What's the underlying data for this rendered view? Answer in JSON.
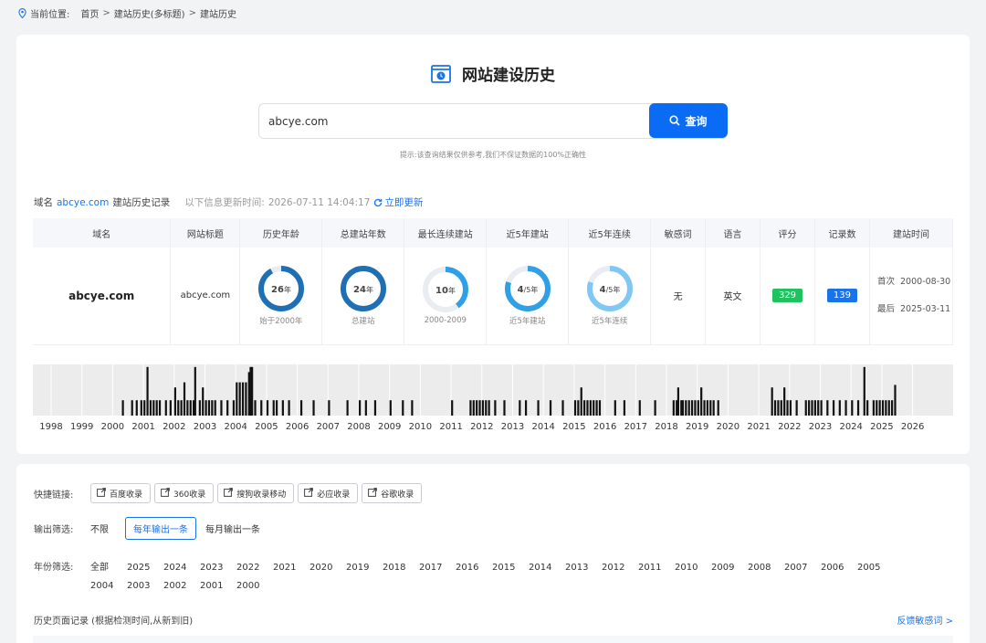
{
  "breadcrumb": {
    "prefix": "当前位置:",
    "items": [
      "首页",
      "建站历史(多标题)",
      "建站历史"
    ],
    "sep": ">"
  },
  "header": {
    "title": "网站建设历史"
  },
  "search": {
    "value": "abcye.com",
    "button_label": "查询"
  },
  "tip": "提示:该查询结果仅供参考,我们不保证数据的100%正确性",
  "info": {
    "prefix": "域名",
    "domain": "abcye.com",
    "suffix": "建站历史记录",
    "updated_label": "以下信息更新时间:",
    "updated_time": "2026-07-11 14:04:17",
    "refresh_label": "立即更新"
  },
  "table": {
    "headers": [
      "域名",
      "网站标题",
      "历史年龄",
      "总建站年数",
      "最长连续建站",
      "近5年建站",
      "近5年连续",
      "敏感词",
      "语言",
      "评分",
      "记录数",
      "建站时间"
    ],
    "domain": "abcye.com",
    "site_title": "abcye.com",
    "rings": [
      {
        "main": "26",
        "unit": "年",
        "sub": "始于2000年",
        "fraction": 0.92,
        "color": "#1f6fb5"
      },
      {
        "main": "24",
        "unit": "年",
        "sub": "总建站",
        "fraction": 1.0,
        "color": "#1f6fb5"
      },
      {
        "main": "10",
        "unit": "年",
        "sub": "2000-2009",
        "fraction": 0.4,
        "color": "#2fa0e6"
      },
      {
        "main": "4",
        "unit": "/5年",
        "sub": "近5年建站",
        "fraction": 0.8,
        "color": "#2fa0e6"
      },
      {
        "main": "4",
        "unit": "/5年",
        "sub": "近5年连续",
        "fraction": 0.8,
        "color": "#7fc8f5"
      }
    ],
    "sensitive": "无",
    "language": "英文",
    "score": "329",
    "score_color": "#1ec25e",
    "records": "139",
    "records_color": "#1a73e8",
    "first_label": "首次",
    "first_date": "2000-08-30",
    "last_label": "最后",
    "last_date": "2025-03-11"
  },
  "timeline": {
    "years": [
      "1998",
      "1999",
      "2000",
      "2001",
      "2002",
      "2003",
      "2004",
      "2005",
      "2006",
      "2007",
      "2008",
      "2009",
      "2010",
      "2011",
      "2012",
      "2013",
      "2014",
      "2015",
      "2016",
      "2017",
      "2018",
      "2019",
      "2020",
      "2021",
      "2022",
      "2023",
      "2024",
      "2025",
      "2026"
    ],
    "bar_color": "#111111",
    "bars": [
      [
        2000.3,
        0.3
      ],
      [
        2000.6,
        0.3
      ],
      [
        2000.75,
        0.3
      ],
      [
        2000.9,
        0.3
      ],
      [
        2001.0,
        0.3
      ],
      [
        2001.1,
        0.95
      ],
      [
        2001.2,
        0.3
      ],
      [
        2001.3,
        0.3
      ],
      [
        2001.4,
        0.3
      ],
      [
        2001.5,
        0.3
      ],
      [
        2001.7,
        0.3
      ],
      [
        2001.85,
        0.3
      ],
      [
        2002.0,
        0.55
      ],
      [
        2002.1,
        0.3
      ],
      [
        2002.2,
        0.3
      ],
      [
        2002.3,
        0.65
      ],
      [
        2002.4,
        0.3
      ],
      [
        2002.5,
        0.3
      ],
      [
        2002.6,
        0.3
      ],
      [
        2002.65,
        0.95
      ],
      [
        2002.8,
        0.3
      ],
      [
        2002.9,
        0.55
      ],
      [
        2003.0,
        0.3
      ],
      [
        2003.1,
        0.3
      ],
      [
        2003.2,
        0.3
      ],
      [
        2003.3,
        0.3
      ],
      [
        2003.5,
        0.3
      ],
      [
        2003.7,
        0.3
      ],
      [
        2003.9,
        0.3
      ],
      [
        2004.0,
        0.65
      ],
      [
        2004.1,
        0.65
      ],
      [
        2004.2,
        0.65
      ],
      [
        2004.3,
        0.65
      ],
      [
        2004.4,
        0.85
      ],
      [
        2004.45,
        0.95
      ],
      [
        2004.5,
        0.95
      ],
      [
        2004.6,
        0.3
      ],
      [
        2004.8,
        0.3
      ],
      [
        2005.0,
        0.3
      ],
      [
        2005.2,
        0.3
      ],
      [
        2005.3,
        0.3
      ],
      [
        2005.5,
        0.3
      ],
      [
        2005.7,
        0.3
      ],
      [
        2006.1,
        0.3
      ],
      [
        2006.5,
        0.3
      ],
      [
        2007.0,
        0.3
      ],
      [
        2007.6,
        0.3
      ],
      [
        2008.0,
        0.3
      ],
      [
        2008.2,
        0.3
      ],
      [
        2008.5,
        0.3
      ],
      [
        2009.0,
        0.3
      ],
      [
        2009.4,
        0.3
      ],
      [
        2009.7,
        0.3
      ],
      [
        2011.0,
        0.3
      ],
      [
        2011.6,
        0.3
      ],
      [
        2011.7,
        0.3
      ],
      [
        2011.8,
        0.3
      ],
      [
        2011.9,
        0.3
      ],
      [
        2012.0,
        0.3
      ],
      [
        2012.1,
        0.3
      ],
      [
        2012.2,
        0.3
      ],
      [
        2012.4,
        0.3
      ],
      [
        2012.7,
        0.3
      ],
      [
        2013.2,
        0.3
      ],
      [
        2013.4,
        0.3
      ],
      [
        2013.8,
        0.3
      ],
      [
        2014.2,
        0.3
      ],
      [
        2014.6,
        0.3
      ],
      [
        2015.0,
        0.3
      ],
      [
        2015.1,
        0.3
      ],
      [
        2015.2,
        0.55
      ],
      [
        2015.3,
        0.3
      ],
      [
        2015.4,
        0.3
      ],
      [
        2015.5,
        0.3
      ],
      [
        2015.6,
        0.3
      ],
      [
        2015.7,
        0.3
      ],
      [
        2015.8,
        0.3
      ],
      [
        2016.3,
        0.3
      ],
      [
        2016.6,
        0.3
      ],
      [
        2017.1,
        0.3
      ],
      [
        2017.6,
        0.3
      ],
      [
        2018.2,
        0.3
      ],
      [
        2018.3,
        0.3
      ],
      [
        2018.35,
        0.55
      ],
      [
        2018.45,
        0.3
      ],
      [
        2018.5,
        0.3
      ],
      [
        2018.6,
        0.3
      ],
      [
        2018.7,
        0.3
      ],
      [
        2018.8,
        0.3
      ],
      [
        2018.9,
        0.3
      ],
      [
        2019.0,
        0.3
      ],
      [
        2019.1,
        0.55
      ],
      [
        2019.2,
        0.3
      ],
      [
        2019.3,
        0.3
      ],
      [
        2019.4,
        0.3
      ],
      [
        2019.5,
        0.3
      ],
      [
        2019.65,
        0.3
      ],
      [
        2021.4,
        0.55
      ],
      [
        2021.5,
        0.3
      ],
      [
        2021.6,
        0.3
      ],
      [
        2021.7,
        0.3
      ],
      [
        2021.8,
        0.55
      ],
      [
        2021.9,
        0.3
      ],
      [
        2022.0,
        0.3
      ],
      [
        2022.2,
        0.3
      ],
      [
        2022.5,
        0.3
      ],
      [
        2022.6,
        0.3
      ],
      [
        2022.7,
        0.3
      ],
      [
        2022.8,
        0.3
      ],
      [
        2022.9,
        0.3
      ],
      [
        2023.0,
        0.3
      ],
      [
        2023.2,
        0.3
      ],
      [
        2023.4,
        0.3
      ],
      [
        2023.6,
        0.3
      ],
      [
        2023.8,
        0.3
      ],
      [
        2024.0,
        0.3
      ],
      [
        2024.2,
        0.3
      ],
      [
        2024.4,
        0.95
      ],
      [
        2024.5,
        0.3
      ],
      [
        2024.7,
        0.3
      ],
      [
        2024.8,
        0.3
      ],
      [
        2024.9,
        0.3
      ],
      [
        2025.0,
        0.3
      ],
      [
        2025.1,
        0.3
      ],
      [
        2025.2,
        0.3
      ],
      [
        2025.3,
        0.3
      ],
      [
        2025.4,
        0.6
      ]
    ]
  },
  "quick_links": {
    "label": "快捷链接:",
    "items": [
      "百度收录",
      "360收录",
      "搜狗收录移动",
      "必应收录",
      "谷歌收录"
    ]
  },
  "output_filter": {
    "label": "输出筛选:",
    "options": [
      "不限",
      "每年输出一条",
      "每月输出一条"
    ]
  },
  "year_filter": {
    "label": "年份筛选:",
    "row1": [
      "全部",
      "2025",
      "2024",
      "2023",
      "2022",
      "2021",
      "2020",
      "2019",
      "2018",
      "2017",
      "2016",
      "2015",
      "2014",
      "2013",
      "2012",
      "2011",
      "2010",
      "2009",
      "2008",
      "2007",
      "2006",
      "2005"
    ],
    "row2": [
      "2004",
      "2003",
      "2002",
      "2001",
      "2000"
    ]
  },
  "history": {
    "title": "历史页面记录 (根据检测时间,从新到旧)",
    "feedback": "反馈敏感词 >"
  }
}
